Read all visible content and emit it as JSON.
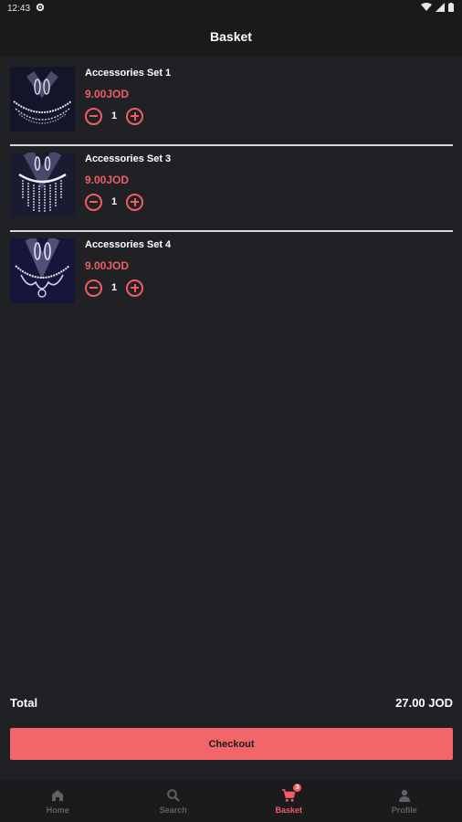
{
  "status_bar": {
    "time": "12:43"
  },
  "header": {
    "title": "Basket"
  },
  "basket": {
    "items": [
      {
        "name": "Accessories Set 1",
        "price": "9.00JOD",
        "quantity": "1"
      },
      {
        "name": "Accessories Set 3",
        "price": "9.00JOD",
        "quantity": "1"
      },
      {
        "name": "Accessories Set 4",
        "price": "9.00JOD",
        "quantity": "1"
      }
    ]
  },
  "summary": {
    "total_label": "Total",
    "total_value": "27.00 JOD"
  },
  "checkout": {
    "label": "Checkout"
  },
  "bottom_nav": {
    "items": [
      {
        "label": "Home",
        "icon": "home-icon"
      },
      {
        "label": "Search",
        "icon": "search-icon"
      },
      {
        "label": "Basket",
        "icon": "cart-icon",
        "badge": "3"
      },
      {
        "label": "Profile",
        "icon": "person-icon"
      }
    ],
    "active": "Basket"
  },
  "colors": {
    "background": "#202124",
    "bar": "#1a1a1c",
    "accent": "#f05d63",
    "checkout_button": "#f2666a",
    "nav_inactive": "#5f6165"
  }
}
